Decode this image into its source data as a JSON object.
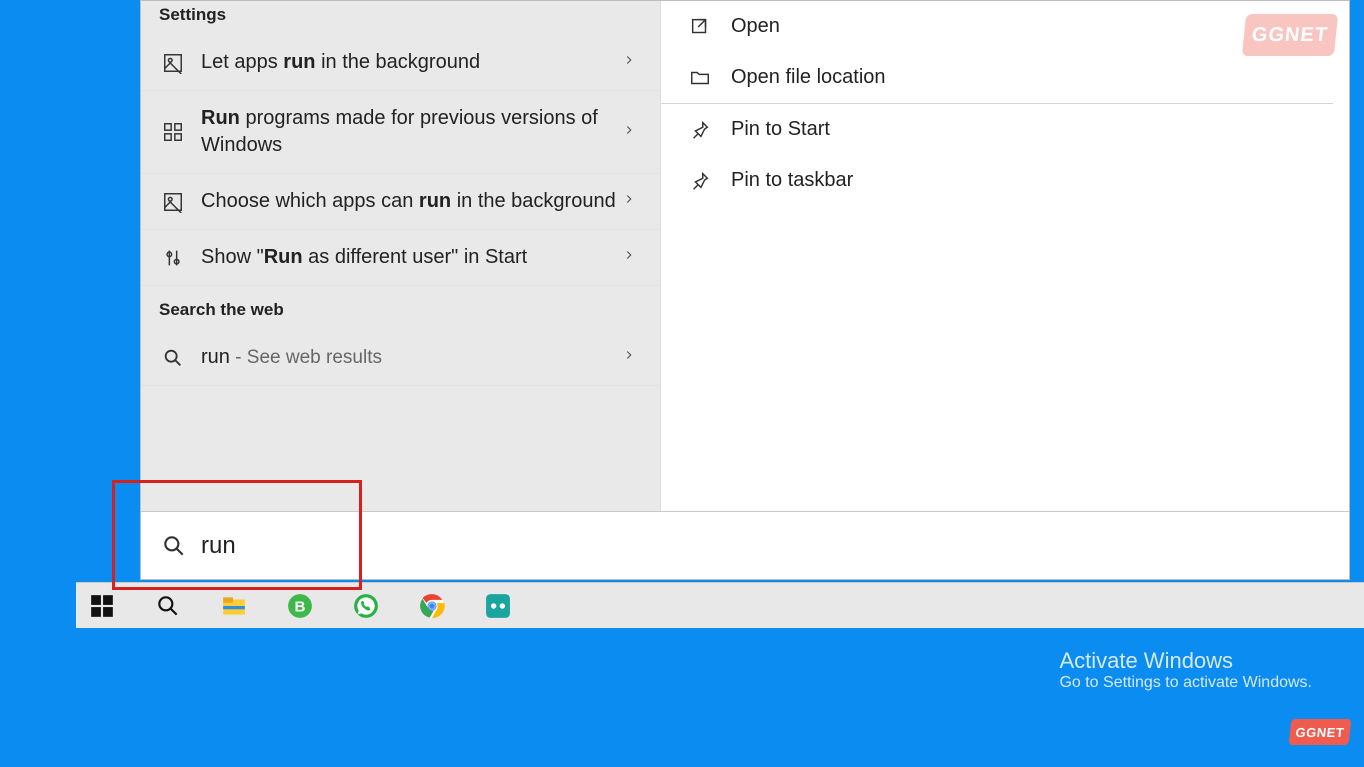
{
  "left": {
    "settings_header": "Settings",
    "items": [
      {
        "text_pre": "Let apps ",
        "bold": "run",
        "text_post": " in the background",
        "icon": "picture"
      },
      {
        "bold": "Run",
        "text_post": " programs made for previous versions of Windows",
        "icon": "grid"
      },
      {
        "text_pre": "Choose which apps can ",
        "bold": "run",
        "text_post": " in the background",
        "icon": "picture"
      },
      {
        "text_pre": "Show \"",
        "bold": "Run",
        "text_post": " as different user\" in Start",
        "icon": "toggle"
      }
    ],
    "webheader": "Search the web",
    "web": {
      "query": "run",
      "suffix": " - See web results"
    }
  },
  "right": {
    "actions": [
      {
        "label": "Open",
        "icon": "open"
      },
      {
        "label": "Open file location",
        "icon": "folder"
      },
      {
        "label": "Pin to Start",
        "icon": "pin"
      },
      {
        "label": "Pin to taskbar",
        "icon": "pin"
      }
    ]
  },
  "search": {
    "value": "run"
  },
  "activate": {
    "l1": "Activate Windows",
    "l2": "Go to Settings to activate Windows."
  },
  "badge": "GGNET"
}
